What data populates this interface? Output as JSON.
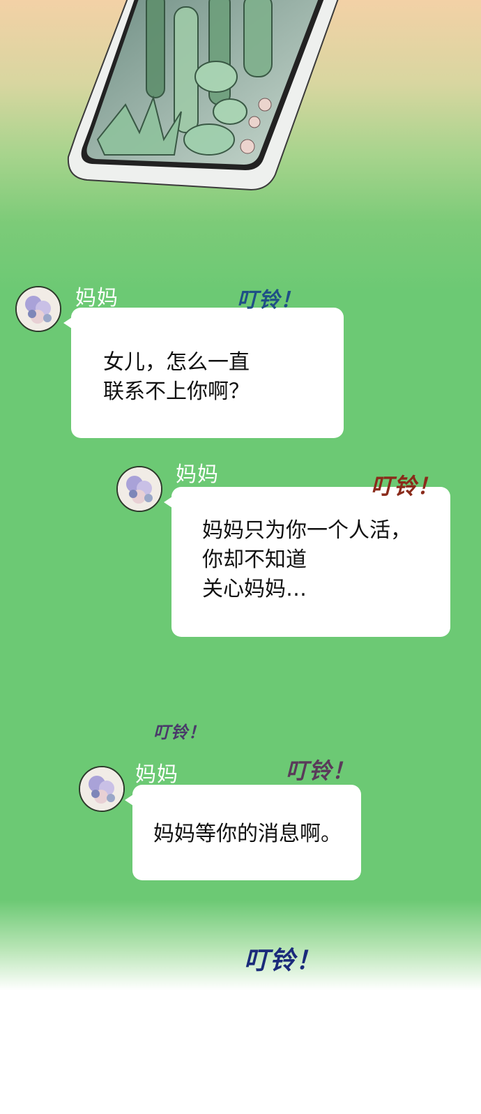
{
  "messages": [
    {
      "sender": "妈妈",
      "lines": [
        "女儿，怎么一直",
        "联系不上你啊？"
      ]
    },
    {
      "sender": "妈妈",
      "lines": [
        "妈妈只为你一个人活，",
        "你却不知道",
        "关心妈妈…"
      ]
    },
    {
      "sender": "妈妈",
      "lines": [
        "妈妈等你的消息啊。"
      ]
    }
  ],
  "sound_effects": [
    "叮铃！",
    "叮铃！",
    "叮铃！",
    "叮铃！",
    "叮铃！"
  ],
  "colors": {
    "chat_background": "#6cc974",
    "bubble": "#ffffff",
    "sfx_1": "#1f4f86",
    "sfx_2": "#8a2a1a",
    "sfx_3": "#4a3a6a",
    "sfx_4": "#5a3a5a",
    "sfx_5": "#1a2a7a"
  },
  "icons": {
    "avatar": "flower-bouquet-avatar-icon",
    "phone": "smartphone-icon"
  }
}
